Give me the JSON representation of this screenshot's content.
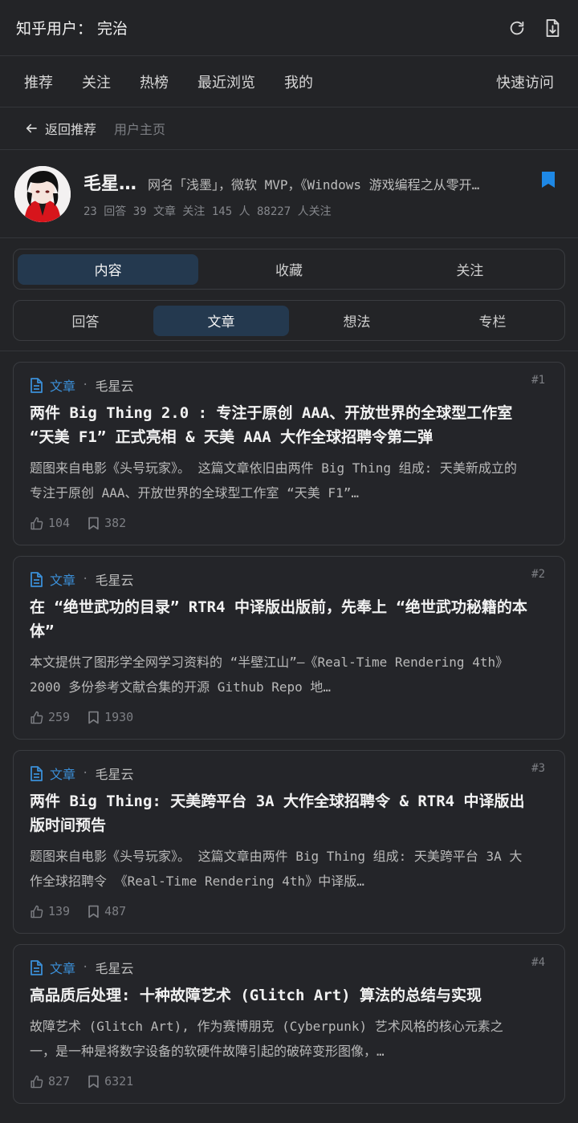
{
  "topbar": {
    "title": "知乎用户： 完治",
    "refresh_icon": "refresh-icon",
    "download_icon": "download-icon"
  },
  "nav": {
    "items": [
      "推荐",
      "关注",
      "热榜",
      "最近浏览",
      "我的"
    ],
    "quick": "快速访问"
  },
  "subnav": {
    "back": "返回推荐",
    "crumb": "用户主页"
  },
  "profile": {
    "name": "毛星…",
    "desc": "网名「浅墨」，微软 MVP，《Windows 游戏编程之从零开…",
    "stats": "23 回答  39 文章  关注 145 人  88227 人关注"
  },
  "tabs1": [
    "内容",
    "收藏",
    "关注"
  ],
  "tabs2": [
    "回答",
    "文章",
    "想法",
    "专栏"
  ],
  "cards": [
    {
      "tag": "文章",
      "author": "毛星云",
      "rank": "#1",
      "title": "两件 Big Thing 2.0 : 专注于原创 AAA、开放世界的全球型工作室 “天美 F1” 正式亮相 & 天美 AAA 大作全球招聘令第二弹",
      "excerpt": "题图来自电影《头号玩家》。 这篇文章依旧由两件 Big Thing 组成: 天美新成立的专注于原创 AAA、开放世界的全球型工作室 “天美 F1”…",
      "likes": "104",
      "saves": "382"
    },
    {
      "tag": "文章",
      "author": "毛星云",
      "rank": "#2",
      "title": "在 “绝世武功的目录” RTR4 中译版出版前，先奉上 “绝世武功秘籍的本体”",
      "excerpt": "本文提供了图形学全网学习资料的 “半壁江山”—《Real-Time Rendering 4th》2000 多份参考文献合集的开源 Github Repo 地…",
      "likes": "259",
      "saves": "1930"
    },
    {
      "tag": "文章",
      "author": "毛星云",
      "rank": "#3",
      "title": "两件 Big Thing: 天美跨平台 3A 大作全球招聘令 & RTR4 中译版出版时间预告",
      "excerpt": "题图来自电影《头号玩家》。 这篇文章由两件 Big Thing 组成: 天美跨平台 3A 大作全球招聘令 《Real-Time Rendering 4th》中译版…",
      "likes": "139",
      "saves": "487"
    },
    {
      "tag": "文章",
      "author": "毛星云",
      "rank": "#4",
      "title": "高品质后处理: 十种故障艺术 (Glitch Art) 算法的总结与实现",
      "excerpt": "故障艺术 (Glitch Art), 作为赛博朋克 (Cyberpunk) 艺术风格的核心元素之一，是一种是将数字设备的软硬件故障引起的破碎变形图像，…",
      "likes": "827",
      "saves": "6321"
    }
  ],
  "colors": {
    "accent": "#3b8fd8",
    "bookmark": "#1e88e5",
    "tab_active": "#24394f"
  }
}
